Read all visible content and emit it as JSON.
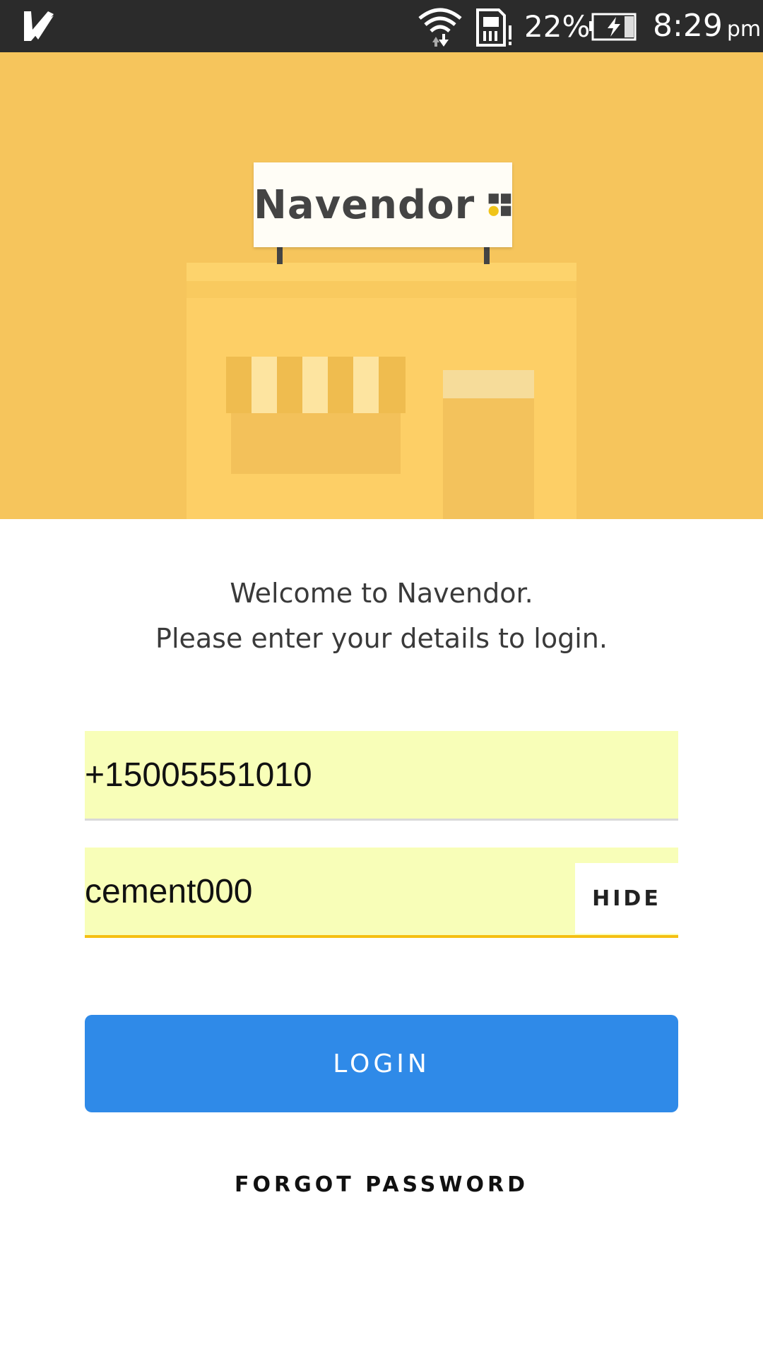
{
  "status_bar": {
    "app_icon": "check-icon",
    "wifi_icon": "wifi-icon",
    "sim_icon": "sim-alert-icon",
    "battery_percent": "22%",
    "battery_icon": "battery-charging-icon",
    "time": "8:29",
    "ampm": "pm"
  },
  "hero": {
    "sign_text": "Navendor",
    "logo_icon": "navendor-logo-icon",
    "background_color": "#f6c55c"
  },
  "welcome": {
    "line1": "Welcome to Navendor.",
    "line2": "Please enter your details to login."
  },
  "form": {
    "phone_value": "+15005551010",
    "password_value": "cement000",
    "hide_label": "HIDE",
    "field_background": "#f8feb8",
    "focus_underline_color": "#f5bf12"
  },
  "actions": {
    "login_label": "LOGIN",
    "login_color": "#2f8ae8",
    "forgot_label": "FORGOT PASSWORD"
  }
}
